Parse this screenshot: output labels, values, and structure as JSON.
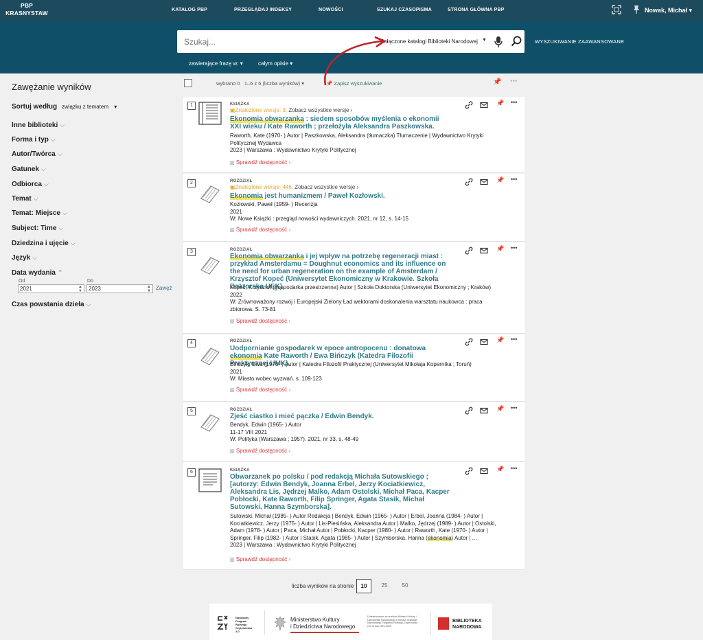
{
  "header": {
    "brand_line1": "PBP",
    "brand_line2": "KRASNYSTAW",
    "nav": [
      "KATALOG PBP",
      "PRZEGLĄDAJ INDEKSY",
      "NOWOŚCI",
      "SZUKAJ CZASOPISMA",
      "STRONA GŁÓWNA PBP"
    ],
    "user": "Nowak, Michał"
  },
  "search": {
    "placeholder": "Szukaj...",
    "catalog": "Połączone katalogi Biblioteki Narodowej",
    "advanced": "WYSZUKIWANIE ZAAWANSOWANE",
    "filter_phrase": "zawierające frazę w:",
    "filter_scope": "całym opisie"
  },
  "sidebar": {
    "title": "Zawężanie wyników",
    "sort_label": "Sortuj według",
    "sort_value": "związku z tematem",
    "facets": [
      "Inne biblioteki",
      "Forma i typ",
      "Autor/Twórca",
      "Gatunek",
      "Odbiorca",
      "Temat",
      "Temat: Miejsce",
      "Subject: Time",
      "Dziedzina i ujęcie",
      "Język"
    ],
    "date_facet": "Data wydania",
    "date_from_label": "Od",
    "date_to_label": "Do",
    "date_from": "2021",
    "date_to": "2023",
    "apply": "Zawęź",
    "last_facet": "Czas powstania dzieła"
  },
  "results_header": {
    "selected": "wybrano 0",
    "range": "1–6 z 6 (liczba wyników)",
    "save_search": "Zapisz wyszukiwanie"
  },
  "results": [
    {
      "num": "1",
      "type": "KSIĄŻKA",
      "found": "Znalezione wersje: 3.",
      "see_all": "Zobacz wszystkie wersje",
      "title_hl": "Ekonomia obwarzanka",
      "title_rest": " : siedem sposobów myślenia o ekonomii XXI wieku / Kate Raworth ; przełożyła Aleksandra Paszkowska.",
      "meta": [
        "Raworth, Kate (1970- ) Autor | Paszkowska, Aleksandra (tłumaczka) Tłumaczenie | Wydawnictwo Krytyki Politycznej Wydawca",
        "2023 | Warszawa : Wydawnictwo Krytyki Politycznej"
      ],
      "avail": "Sprawdź dostępność"
    },
    {
      "num": "2",
      "type": "ROZDZIAŁ",
      "found": "Znalezione wersje: 446.",
      "see_all": "Zobacz wszystkie wersje",
      "title_hl": "Ekonomia",
      "title_rest": " jest humanizmem / Paweł Kozłowski.",
      "meta": [
        "Kozłowski, Paweł (1959- ) Recenzja",
        "2021",
        "W: Nowe Książki : przegląd nowości wydawniczych. 2021, nr 12, s. 14-15"
      ],
      "avail": "Sprawdź dostępność"
    },
    {
      "num": "3",
      "type": "ROZDZIAŁ",
      "title_hl": "Ekonomia obwarzanka",
      "title_rest": " i jej wpływ na potrzebę regeneracji miast : przykład Amsterdamu = Doughnut economics and its influence on the need for urban regeneration on the example of Amsterdam / Krzysztof Kopeć (Uniwersytet Ekonomiczny w Krakowie. Szkoła Doktorska UEK).",
      "meta": [
        "Kopeć, Krzysztof (gospodarka przestrzenna) Autor | Szkoła Doktorska (Uniwersytet Ekonomiczny ; Kraków)",
        "2022",
        "W: Zrównoważony rozwój i Europejski Zielony Ład wektorami doskonalenia warsztatu naukowca : praca zbiorowa. S. 73-81"
      ],
      "avail": "Sprawdź dostępność"
    },
    {
      "num": "4",
      "type": "ROZDZIAŁ",
      "title_pre": "Uodpornianie gospodarek w epoce antropocenu : donatowa ",
      "title_hl": "ekonomia",
      "title_rest": " Kate Raworth / Ewa Bińczyk (Katedra Filozofii Praktycznej UMK).",
      "meta": [
        "Bińczyk, Ewa (1976- ) Autor | Katedra Filozofii Praktycznej (Uniwersytet Mikołaja Kopernika ; Toruń)",
        "2021",
        "W: Miasto wobec wyzwań. s. 109-123"
      ],
      "avail": "Sprawdź dostępność"
    },
    {
      "num": "5",
      "type": "ROZDZIAŁ",
      "title_rest": "Zjeść ciastko i mieć pączka / Edwin Bendyk.",
      "meta": [
        "Bendyk, Edwin (1965- ) Autor",
        "11-17 VIII 2021",
        "W: Polityka (Warszawa ; 1957). 2021, nr 33, s. 48-49"
      ],
      "avail": "Sprawdź dostępność"
    },
    {
      "num": "6",
      "type": "KSIĄŻKA",
      "title_rest": "Obwarzanek po polsku / pod redakcją Michała Sutowskiego ; [autorzy: Edwin Bendyk, Joanna Erbel, Jerzy Kociatkiewicz, Aleksandra Lis, Jędrzej Malko, Adam Ostolski, Michał Paca, Kacper Pobłocki, Kate Raworth, Filip Springer, Agata Stasik, Michał Sutowski, Hanna Szymborska].",
      "meta_pre": "Sutowski, Michał (1985- ) Autor Redakcja | Bendyk, Edwin (1965- ) Autor | Erbel, Joanna (1984- ) Autor | Kociatkiewicz, Jerzy (1975- ) Autor | Lis-Plesińska, Aleksandra Autor | Malko, Jędrzej (1989- ) Autor | Ostolski, Adam (1978- ) Autor | Paca, Michał Autor | Pobłocki, Kacper (1980- ) Autor | Raworth, Kate (1970- ) Autor | Springer, Filip (1982- ) Autor | Stasik, Agata (1985- ) Autor | Szymborska, Hanna (",
      "meta_hl": "ekonomia",
      "meta_post": ") Autor | ...",
      "meta_last": "2023 | Warszawa : Wydawnictwo Krytyki Politycznej",
      "avail": "Sprawdź dostępność"
    }
  ],
  "pagination": {
    "label": "liczba wyników na stronie",
    "options": [
      "10",
      "25",
      "50"
    ],
    "active": "10"
  },
  "footer": {
    "nprc": [
      "Narodowy",
      "Program",
      "Rozwoju",
      "Czytelnictwa",
      "2.0"
    ],
    "ministry": [
      "Ministerstwo Kultury",
      "i Dziedzictwa Narodowego"
    ],
    "note": "Dofinansowano ze środków Ministra Kultury i Dziedzictwa Narodowego w ramach realizacji Narodowego Programu Rozwoju Czytelnictwa 2.0 na lata 2021-2025",
    "bn": [
      "BIBLIOTEKA",
      "NARODOWA"
    ]
  },
  "colors": {
    "topbar": "#1e4a5d",
    "band": "#0f5068",
    "title_link": "#2f7a8a",
    "highlight": "#f2e56b",
    "availability": "#d23a3a",
    "found_versions": "#e3a72f"
  }
}
